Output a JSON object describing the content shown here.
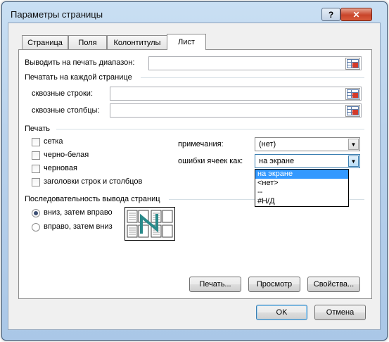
{
  "window": {
    "title": "Параметры страницы",
    "help_label": "?",
    "close_label": "✕"
  },
  "tabs": [
    {
      "label": "Страница",
      "active": false
    },
    {
      "label": "Поля",
      "active": false
    },
    {
      "label": "Колонтитулы",
      "active": false
    },
    {
      "label": "Лист",
      "active": true
    }
  ],
  "sheet": {
    "print_area_label": "Выводить на печать диапазон:",
    "print_area_value": "",
    "print_titles_header": "Печатать на каждой странице",
    "rows_label": "сквозные строки:",
    "rows_value": "",
    "cols_label": "сквозные столбцы:",
    "cols_value": "",
    "print_header": "Печать",
    "checkboxes": [
      {
        "label": "сетка",
        "checked": false
      },
      {
        "label": "черно-белая",
        "checked": false
      },
      {
        "label": "черновая",
        "checked": false
      },
      {
        "label": "заголовки строк и столбцов",
        "checked": false
      }
    ],
    "comments_label": "примечания:",
    "comments_value": "(нет)",
    "errors_label": "ошибки ячеек как:",
    "errors_value": "на экране",
    "errors_options": [
      "на экране",
      "<нет>",
      "--",
      "#Н/Д"
    ],
    "errors_selected_index": 0,
    "order_header": "Последовательность вывода страниц",
    "radios": [
      {
        "label": "вниз, затем вправо",
        "checked": true
      },
      {
        "label": "вправо, затем вниз",
        "checked": false
      }
    ]
  },
  "buttons": {
    "print": "Печать...",
    "preview": "Просмотр",
    "properties": "Свойства...",
    "ok": "OK",
    "cancel": "Отмена"
  },
  "colors": {
    "accent": "#3399ff",
    "title_bar": "#b9d2ec",
    "close": "#c9452a",
    "arrow": "#2a8a8a"
  },
  "icons": [
    "range-select-icon",
    "page-order-down-then-over-icon",
    "dropdown-arrow-icon"
  ]
}
